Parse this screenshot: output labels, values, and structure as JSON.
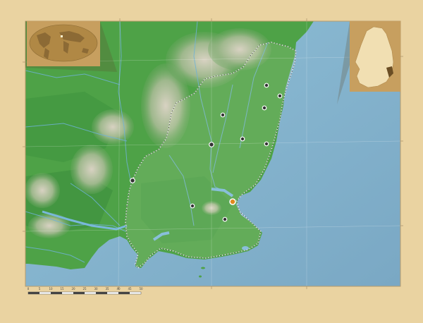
{
  "map": {
    "type": "relief-map-with-locators",
    "water_color": "#7fb3cf",
    "land_color": "#4aa14a",
    "frame_color": "#ead3a1",
    "inset_color": "#c79f5f",
    "region_highlight": "#fff8dc",
    "place_markers": {
      "count": 11,
      "capital_marker": "orange-dot-icon"
    },
    "scale_bar": {
      "ticks": [
        "0",
        "5",
        "10",
        "15",
        "20",
        "25",
        "30",
        "35",
        "40",
        "45",
        "50"
      ]
    },
    "insets": {
      "world_locator": "world-map-icon",
      "country_locator": "ireland-outline-icon"
    }
  }
}
